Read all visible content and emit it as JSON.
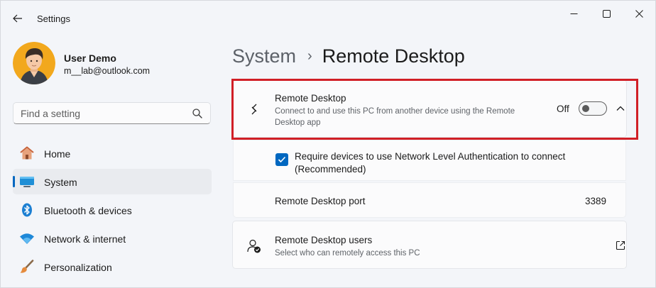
{
  "window": {
    "title": "Settings",
    "controls": {
      "minimize": "minimize",
      "maximize": "maximize",
      "close": "close"
    }
  },
  "profile": {
    "name": "User Demo",
    "email": "m__lab@outlook.com"
  },
  "search": {
    "placeholder": "Find a setting",
    "value": ""
  },
  "nav": {
    "items": [
      {
        "label": "Home",
        "icon": "home-icon",
        "active": false
      },
      {
        "label": "System",
        "icon": "system-monitor-icon",
        "active": true
      },
      {
        "label": "Bluetooth & devices",
        "icon": "bluetooth-icon",
        "active": false
      },
      {
        "label": "Network & internet",
        "icon": "wifi-icon",
        "active": false
      },
      {
        "label": "Personalization",
        "icon": "paintbrush-icon",
        "active": false
      }
    ]
  },
  "breadcrumb": {
    "parent": "System",
    "separator": "›",
    "current": "Remote Desktop"
  },
  "remote_desktop": {
    "title": "Remote Desktop",
    "description_line1": "Connect to and use this PC from another device using the Remote",
    "description_line2": "Desktop app",
    "toggle_state": "Off",
    "toggle_on": false,
    "expanded": true
  },
  "nla": {
    "label_line1": "Require devices to use Network Level Authentication to connect",
    "label_line2": "(Recommended)",
    "checked": true
  },
  "port": {
    "label": "Remote Desktop port",
    "value": "3389"
  },
  "users": {
    "title": "Remote Desktop users",
    "description": "Select who can remotely access this PC"
  },
  "colors": {
    "accent": "#0067c0",
    "highlight": "#d11f26",
    "window_bg": "#f3f5f9",
    "card_bg": "#fbfbfc"
  }
}
